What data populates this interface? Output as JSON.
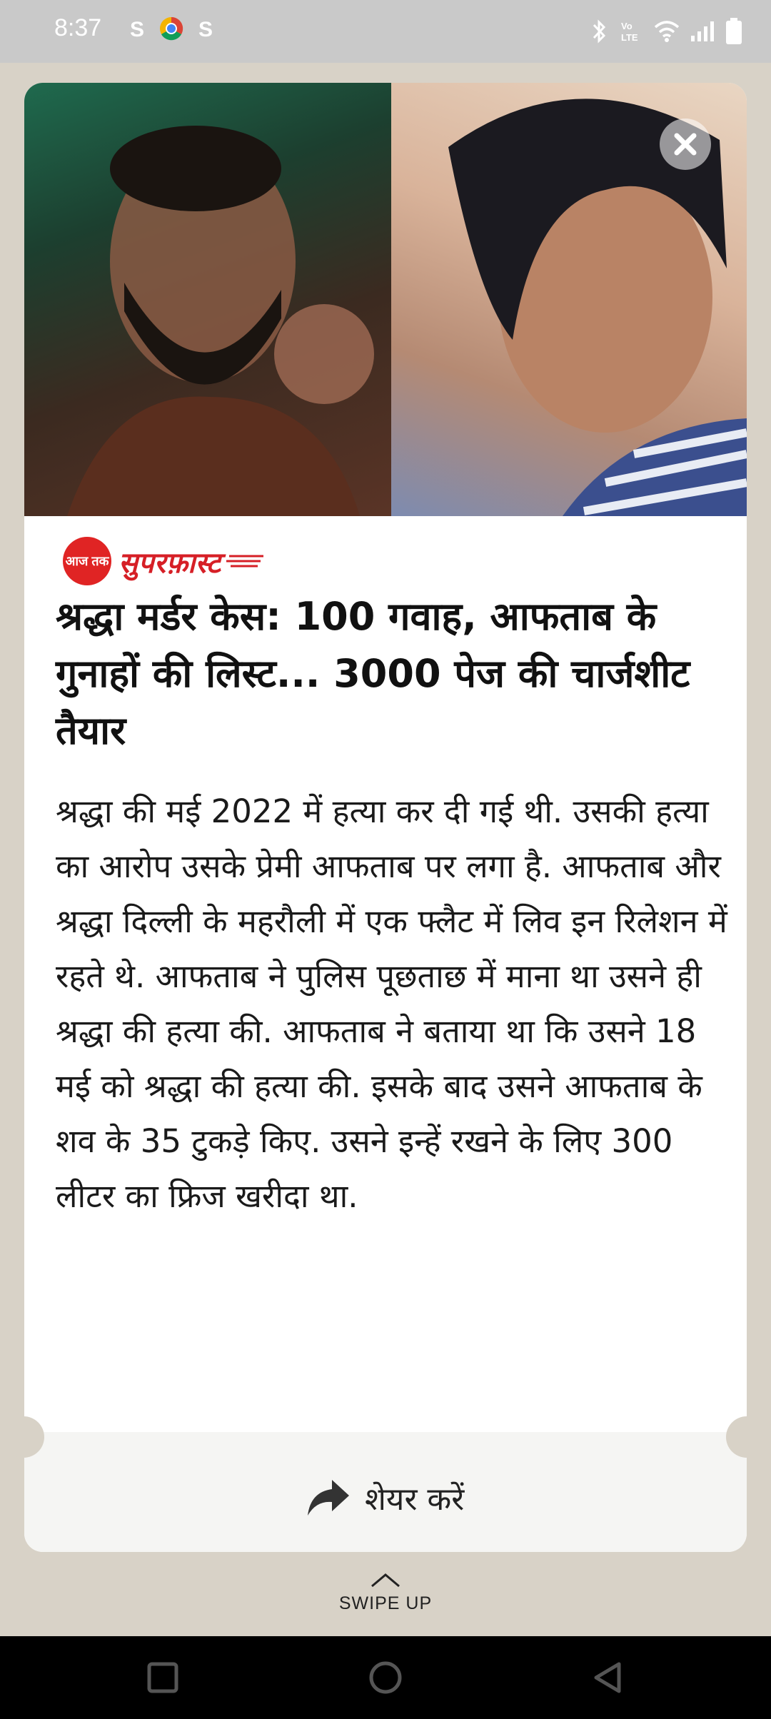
{
  "status_bar": {
    "time": "8:37",
    "notification_icons": [
      "S",
      "S"
    ],
    "system_icons": [
      "bluetooth-icon",
      "volte-icon",
      "wifi-icon",
      "signal-icon",
      "battery-icon"
    ],
    "volte_label": "Vo LTE"
  },
  "card": {
    "brand": {
      "logo_text": "आज तक",
      "name": "सुपरफ़ास्ट",
      "accent_color": "#d61f26"
    },
    "headline": "श्रद्धा मर्डर केस: 100 गवाह, आफताब के गुनाहों की लिस्ट... 3000 पेज की चार्जशीट तैयार",
    "body": "श्रद्धा की मई 2022 में हत्या कर दी गई थी. उसकी हत्या का आरोप उसके प्रेमी आफताब पर लगा है. आफताब और श्रद्धा दिल्ली के महरौली में एक फ्लैट में लिव इन रिलेशन में रहते थे. आफताब ने पुलिस पूछताछ में माना था उसने ही श्रद्धा की हत्या की. आफताब ने बताया था कि उसने 18 मई को श्रद्धा की हत्या की. इसके बाद उसने आफताब के शव के 35 टुकड़े किए. उसने इन्हें रखने के लिए 300 लीटर का फ्रिज खरीदा था.",
    "share_label": "शेयर करें"
  },
  "swipe_label": "SWIPE UP",
  "nav": [
    "recents-button",
    "home-button",
    "back-button"
  ]
}
